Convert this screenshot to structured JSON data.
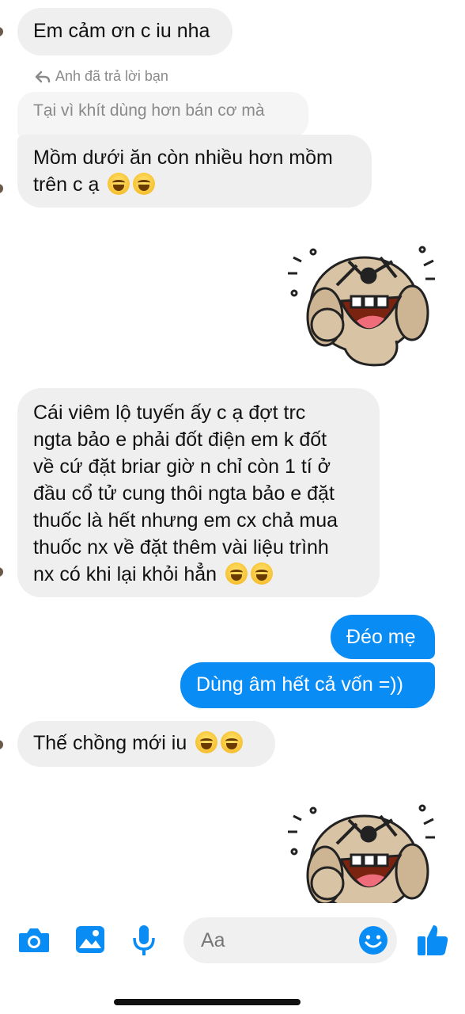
{
  "messages": {
    "m1": "Em cảm ơn c iu nha",
    "reply_note": "Anh đã trả lời bạn",
    "quoted": "Tại vì khít dùng hơn bán cơ mà",
    "m2_line1": "Mồm dưới ăn còn nhiều hơn mồm",
    "m2_line2": "trên c ạ",
    "m3_lines": [
      "Cái viêm lộ tuyến ấy c ạ đợt trc",
      "ngta bảo e phải đốt điện em k đốt",
      "về cứ đặt briar giờ n chỉ còn 1 tí ở",
      "đầu cổ tử cung thôi ngta bảo e đặt",
      "thuốc là hết nhưng em cx chả mua",
      "thuốc nx về đặt thêm vài liệu trình",
      "nx có khi lại khỏi hẳn"
    ],
    "out1": "Đéo mẹ",
    "out2": "Dùng âm hết cả vốn =))",
    "m4": "Thế chồng mới iu"
  },
  "composer": {
    "placeholder": "Aa",
    "icons": [
      "camera-icon",
      "image-icon",
      "microphone-icon",
      "emoji-icon",
      "thumbs-up-icon"
    ],
    "accent": "#0a8cf5"
  },
  "colors": {
    "incoming_bubble": "#efefef",
    "outgoing_bubble": "#0a8cf5"
  }
}
